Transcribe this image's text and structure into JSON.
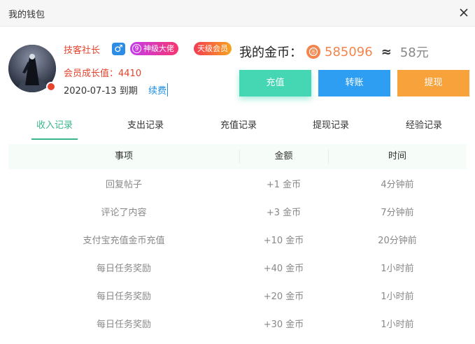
{
  "window": {
    "title": "我的钱包"
  },
  "user": {
    "name": "技客社长",
    "gender_icon": "male-icon",
    "gender_symbol": "♂",
    "rank_level": "9",
    "rank_badge": "神级大佬",
    "vip_badge": "天级会员",
    "growth_label": "会员成长值：",
    "growth_value": "4410",
    "expiry_date": "2020-07-13",
    "expiry_suffix": "到期",
    "renew_label": "续费"
  },
  "wallet": {
    "coins_label": "我的金币：",
    "coin_icon": "coin-icon",
    "coins_amount": "585096",
    "approx_symbol": "≈",
    "yuan_value": "58元",
    "colors": {
      "coin": "#f2854c",
      "recharge": "#45d7b4",
      "transfer": "#2d9ef1",
      "withdraw": "#f7a23b",
      "accent": "#3bb58d",
      "name": "#e8432d"
    }
  },
  "actions": {
    "recharge": "充值",
    "transfer": "转账",
    "withdraw": "提现"
  },
  "tabs": [
    "收入记录",
    "支出记录",
    "充值记录",
    "提现记录",
    "经验记录"
  ],
  "active_tab": 0,
  "table": {
    "headers": [
      "事项",
      "金额",
      "时间"
    ],
    "rows": [
      [
        "回复帖子",
        "+1 金币",
        "4分钟前"
      ],
      [
        "评论了内容",
        "+3 金币",
        "7分钟前"
      ],
      [
        "支付宝充值金币充值",
        "+10 金币",
        "20分钟前"
      ],
      [
        "每日任务奖励",
        "+40 金币",
        "1小时前"
      ],
      [
        "每日任务奖励",
        "+20 金币",
        "1小时前"
      ],
      [
        "每日任务奖励",
        "+30 金币",
        "1小时前"
      ]
    ]
  }
}
